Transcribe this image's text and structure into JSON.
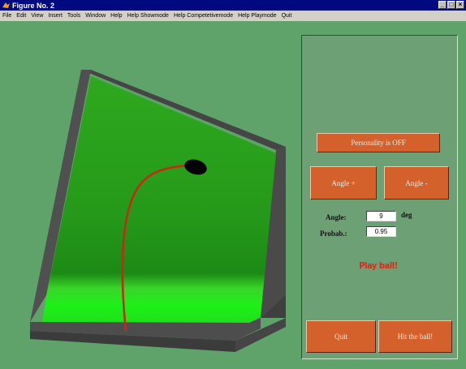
{
  "window": {
    "title": "Figure No. 2",
    "controls": [
      "_",
      "□",
      "×"
    ]
  },
  "menu": {
    "items": [
      "File",
      "Edit",
      "View",
      "Insert",
      "Tools",
      "Window",
      "Help",
      "Help Showmode",
      "Help Competetivemode",
      "Help Playmode",
      "Quit"
    ]
  },
  "panel": {
    "personality_button": "Personality is OFF",
    "angle_plus_button": "Angle +",
    "angle_minus_button": "Angle -",
    "angle_label": "Angle:",
    "angle_value": "9",
    "angle_unit": "deg",
    "prob_label": "Probab.:",
    "prob_value": "0.95",
    "status_text": "Play ball!",
    "quit_button": "Quit",
    "hit_button": "Hit the ball!"
  },
  "colors": {
    "background": "#5fa36a",
    "panel": "#6ea075",
    "button": "#d4602c",
    "status": "#e0281a",
    "trajectory": "#c82814",
    "surface": "#2fae20"
  },
  "icons": {
    "app": "matlab-figure-icon"
  }
}
